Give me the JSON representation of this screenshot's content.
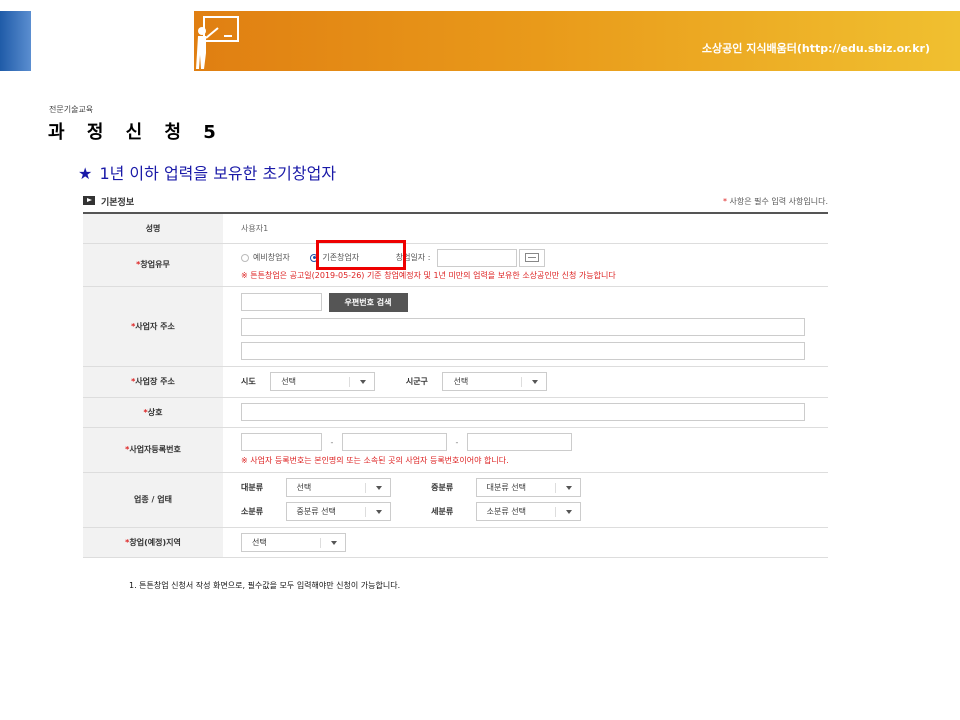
{
  "header": {
    "site": "소상공인 지식배움터(http://edu.sbiz.or.kr)"
  },
  "breadcrumb": "전문기술교육",
  "title": "과 정 신 청 5",
  "subtitle": "1년 이하 업력을 보유한 초기창업자",
  "section": {
    "title": "기본정보",
    "note_mark": "*",
    "note": "사항은 필수 입력 사항입니다."
  },
  "rows": {
    "name": {
      "label": "성명",
      "value": "사용자1"
    },
    "startup": {
      "label": "창업유무",
      "opt1": "예비창업자",
      "opt2": "기존창업자",
      "date_label": "창업일자 :",
      "warning": "※ 튼튼창업은 공고일(2019-05-26) 기준 창업예정자 및 1년 미만의 업력을 보유한 소상공인만 신청 가능합니다"
    },
    "biz_address": {
      "label": "사업자 주소",
      "zip_button": "우편번호 검색"
    },
    "shop_address": {
      "label": "사업장 주소",
      "sido": "시도",
      "sido_sel": "선택",
      "sigungu": "시군구",
      "sigungu_sel": "선택"
    },
    "company": {
      "label": "상호"
    },
    "biz_reg": {
      "label": "사업자등록번호",
      "dash": "-",
      "warning": "※ 사업자 등록번호는 본인명의 또는 소속된 곳의 사업자 등록번호이어야 합니다."
    },
    "industry": {
      "label": "업종 / 업태",
      "major": "대분류",
      "major_sel": "선택",
      "middle": "중분류",
      "middle_sel": "대분류 선택",
      "minor": "소분류",
      "minor_sel": "중분류 선택",
      "detail": "세분류",
      "detail_sel": "소분류 선택"
    },
    "region": {
      "label": "창업(예정)지역",
      "sel": "선택"
    }
  },
  "footnote": "1. 튼튼창업 신청서 작성 화면으로, 필수값을 모두 입력해야만 신청이 가능합니다."
}
